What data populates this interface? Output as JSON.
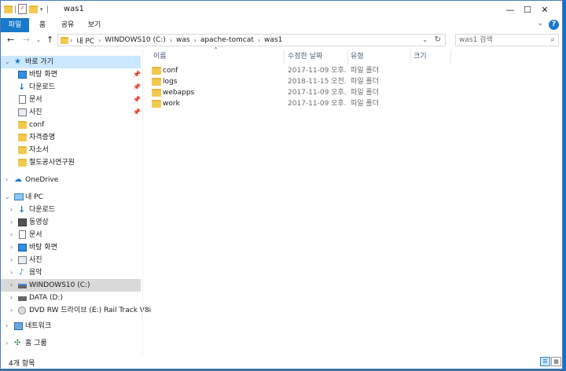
{
  "window": {
    "title": "was1"
  },
  "ribbon": {
    "tabs": [
      "파일",
      "홈",
      "공유",
      "보기"
    ]
  },
  "address": {
    "crumbs": [
      "내 PC",
      "WINDOWS10 (C:)",
      "was",
      "apache-tomcat",
      "was1"
    ]
  },
  "search": {
    "placeholder": "was1 검색"
  },
  "nav": {
    "quick_access": "바로 가기",
    "quick_items": [
      "바탕 화면",
      "다운로드",
      "문서",
      "사진",
      "conf",
      "자격증명",
      "자소서",
      "철도공사연구원"
    ],
    "onedrive": "OneDrive",
    "this_pc": "내 PC",
    "pc_items": [
      "다운로드",
      "동영상",
      "문서",
      "바탕 화면",
      "사진",
      "음악",
      "WINDOWS10 (C:)",
      "DATA (D:)",
      "DVD RW 드라이브 (E:) Rail Track V8i"
    ],
    "network": "네트워크",
    "homegroup": "홈 그룹"
  },
  "columns": {
    "name": "이름",
    "date": "수정한 날짜",
    "type": "유형",
    "size": "크기"
  },
  "files": [
    {
      "name": "conf",
      "date": "2017-11-09 오후...",
      "type": "파일 폴더"
    },
    {
      "name": "logs",
      "date": "2018-11-15 오전...",
      "type": "파일 폴더"
    },
    {
      "name": "webapps",
      "date": "2017-11-09 오후...",
      "type": "파일 폴더"
    },
    {
      "name": "work",
      "date": "2017-11-09 오후...",
      "type": "파일 폴더"
    }
  ],
  "status": {
    "count": "4개 항목"
  },
  "colors": {
    "accent": "#1979ca",
    "folder": "#f3c94f",
    "selected": "#cce8ff"
  }
}
